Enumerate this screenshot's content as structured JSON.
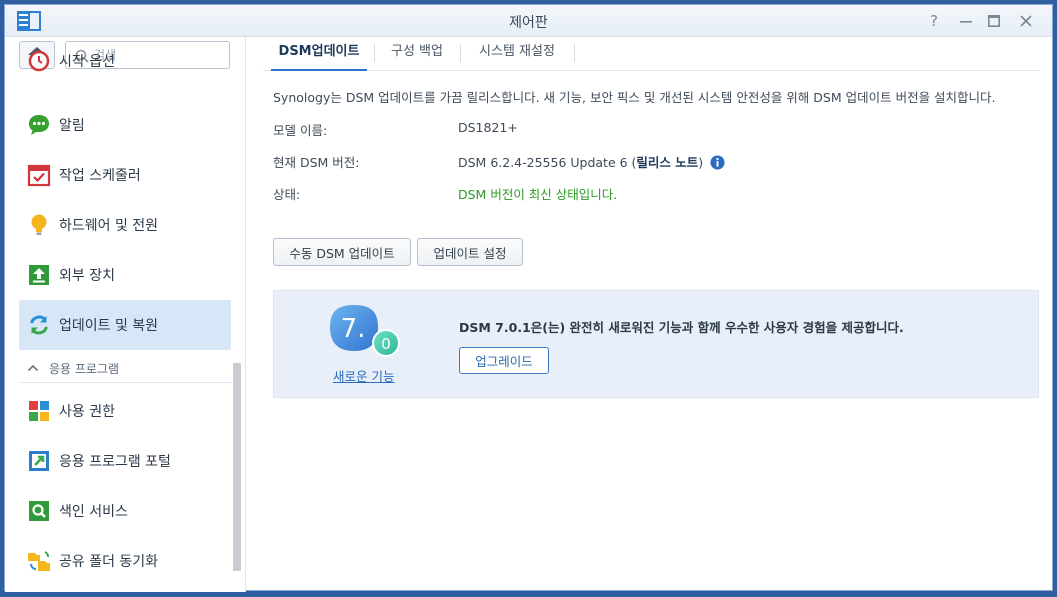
{
  "window": {
    "title": "제어판",
    "controls": [
      "help-icon",
      "minimize-icon",
      "maximize-icon",
      "close-icon"
    ]
  },
  "sidebar": {
    "search_placeholder": "검색",
    "items_top": [
      {
        "label": "시작 옵션",
        "icon": "clock-icon"
      },
      {
        "label": "알림",
        "icon": "chat-icon"
      },
      {
        "label": "작업 스케줄러",
        "icon": "calendar-icon"
      },
      {
        "label": "하드웨어 및 전원",
        "icon": "lightbulb-icon"
      },
      {
        "label": "외부 장치",
        "icon": "upload-icon"
      },
      {
        "label": "업데이트 및 복원",
        "icon": "refresh-icon",
        "active": true
      }
    ],
    "section_label": "응용 프로그램",
    "items_apps": [
      {
        "label": "사용 권한",
        "icon": "grid-icon"
      },
      {
        "label": "응용 프로그램 포털",
        "icon": "portal-icon"
      },
      {
        "label": "색인 서비스",
        "icon": "search-service-icon"
      },
      {
        "label": "공유 폴더 동기화",
        "icon": "folder-sync-icon"
      }
    ]
  },
  "tabs": [
    "DSM업데이트",
    "구성 백업",
    "시스템 재설정"
  ],
  "content": {
    "description": "Synology는 DSM 업데이트를 가끔 릴리스합니다. 새 기능, 보안 픽스 및 개선된 시스템 안전성을 위해 DSM 업데이트 버전을 설치합니다.",
    "model_label": "모델 이름:",
    "model_value": "DS1821+",
    "version_label": "현재 DSM 버전:",
    "version_value": "DSM 6.2.4-25556 Update 6 (",
    "release_notes_link": "릴리스 노트",
    "version_suffix": ")",
    "status_label": "상태:",
    "status_value": "DSM 버전이 최신 상태입니다.",
    "manual_update_button": "수동 DSM 업데이트",
    "update_settings_button": "업데이트 설정"
  },
  "banner": {
    "badge_main": "7.",
    "badge_sub": "0",
    "new_features_link": "새로운 기능",
    "message": "DSM 7.0.1은(는) 완전히 새로워진 기능과 함께 우수한 사용자 경험을 제공합니다.",
    "upgrade_button": "업그레이드"
  },
  "colors": {
    "accent": "#2a74c5",
    "active_item_bg": "#d7e7f7",
    "status_ok": "#2f9a26",
    "banner_bg": "#e8eff9"
  }
}
